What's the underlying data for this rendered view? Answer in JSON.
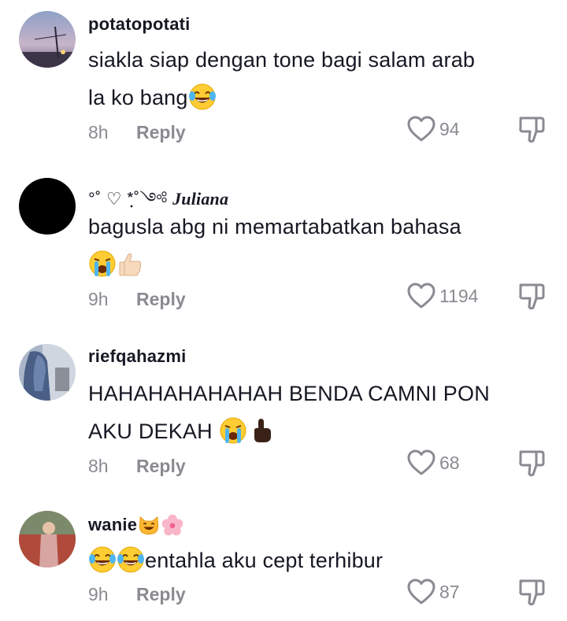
{
  "comments": [
    {
      "username": "potatopotati",
      "text": "siakla siap dengan tone bagi salam arab la ko bang",
      "line1": "siakla siap dengan tone bagi salam arab",
      "line2": "la ko bang",
      "time": "8h",
      "reply_label": "Reply",
      "likes": "94"
    },
    {
      "username_prefix": "°˚ ♡ *ฺ˚༺",
      "username": "Juliana",
      "text": "bagusla abg ni memartabatkan bahasa",
      "time": "9h",
      "reply_label": "Reply",
      "likes": "1194"
    },
    {
      "username": "riefqahazmi",
      "line1": "HAHAHAHAHAHAH BENDA CAMNI PON",
      "line2": "AKU DEKAH",
      "time": "8h",
      "reply_label": "Reply",
      "likes": "68"
    },
    {
      "username": "wanie",
      "text": "entahla aku cept terhibur",
      "time": "9h",
      "reply_label": "Reply",
      "likes": "87"
    }
  ],
  "icons": {
    "like": "heart-outline-icon",
    "dislike": "thumbs-down-outline-icon",
    "emoji_laugh": "face-with-tears-of-joy",
    "emoji_cry": "loudly-crying-face",
    "emoji_thumbs": "thumbs-up-light-skin",
    "emoji_point": "index-pointing-up-dark-skin",
    "emoji_cat": "grinning-cat",
    "emoji_blossom": "cherry-blossom"
  },
  "colors": {
    "text": "#161823",
    "muted": "#8a8b91",
    "background": "#ffffff"
  }
}
